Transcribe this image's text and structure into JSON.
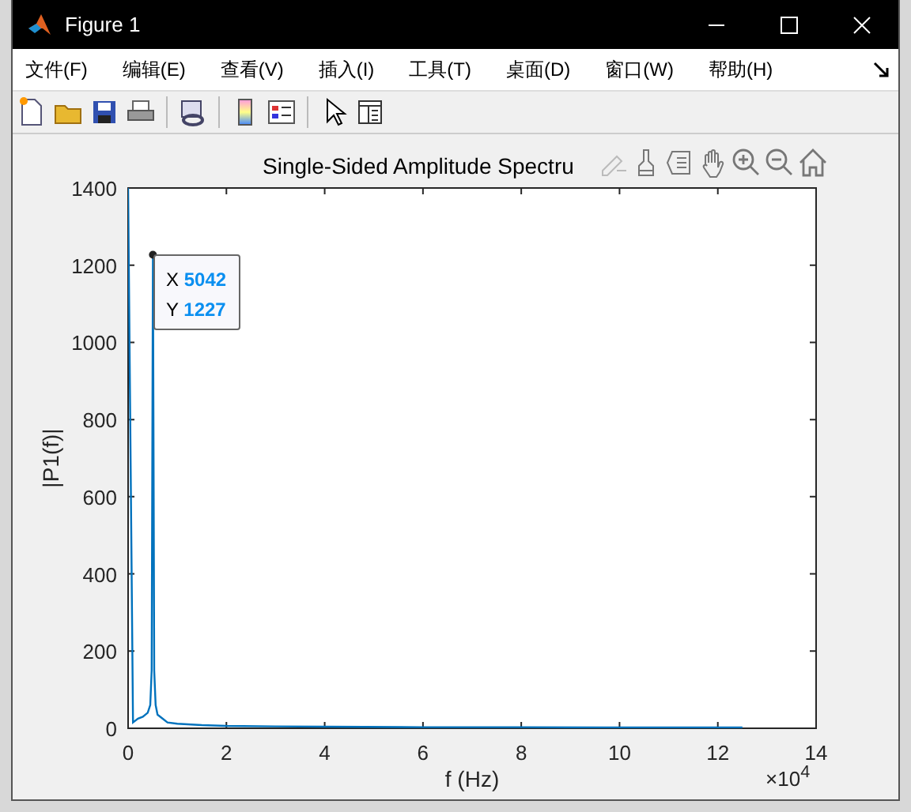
{
  "window": {
    "title": "Figure 1"
  },
  "menu": [
    "文件(F)",
    "编辑(E)",
    "查看(V)",
    "插入(I)",
    "工具(T)",
    "桌面(D)",
    "窗口(W)",
    "帮助(H)"
  ],
  "axes": {
    "title": "Single-Sided Amplitude Spectru",
    "exponent": "×10$^{4}$",
    "chart_data": {
      "type": "line",
      "xlabel": "f (Hz)",
      "ylabel": "|P1(f)|",
      "xlim": [
        0,
        14
      ],
      "ylim": [
        0,
        1400
      ],
      "xticks": [
        0,
        2,
        4,
        6,
        8,
        10,
        12,
        14
      ],
      "yticks": [
        0,
        200,
        400,
        600,
        800,
        1000,
        1200,
        1400
      ],
      "x": [
        0,
        0.1,
        0.2,
        0.3,
        0.4,
        0.45,
        0.48,
        0.5042,
        0.53,
        0.56,
        0.6,
        0.7,
        0.8,
        1,
        1.5,
        2,
        3,
        4,
        6,
        8,
        10,
        12,
        12.5
      ],
      "series": [
        {
          "color": "#0072bd",
          "values": [
            1400,
            15,
            25,
            30,
            40,
            60,
            150,
            1227,
            150,
            60,
            35,
            25,
            15,
            12,
            8,
            6,
            5,
            4,
            3,
            3,
            2,
            2,
            2
          ]
        }
      ]
    },
    "datatip": {
      "x_label": "X",
      "x_value": "5042",
      "y_label": "Y",
      "y_value": "1227"
    }
  }
}
